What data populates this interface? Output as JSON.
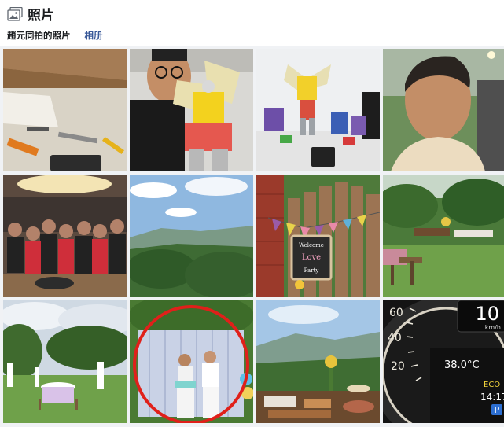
{
  "header": {
    "title": "照片",
    "icon": "photos-icon"
  },
  "tabs": [
    {
      "label": "趙元同拍的照片",
      "active": true
    },
    {
      "label": "相册",
      "active": false
    }
  ],
  "colors": {
    "link": "#385898",
    "annotation_circle": "#e0201a"
  },
  "grid_photos": [
    {
      "name": "photo-workbench-tools"
    },
    {
      "name": "photo-selfie-with-robot-toy"
    },
    {
      "name": "photo-robot-toys-on-table"
    },
    {
      "name": "photo-man-portrait-outdoor"
    },
    {
      "name": "photo-group-dinner"
    },
    {
      "name": "photo-mountain-view"
    },
    {
      "name": "photo-welcome-sign-fence"
    },
    {
      "name": "photo-garden-party-tables"
    },
    {
      "name": "photo-outdoor-wedding"
    },
    {
      "name": "photo-couple-backdrop-circled"
    },
    {
      "name": "photo-mountain-food-table"
    },
    {
      "name": "photo-car-dashboard"
    }
  ],
  "dashboard": {
    "speed": "10",
    "speed_unit": "km/h",
    "temperature": "38.0°C",
    "mode": "ECO",
    "time": "14:17",
    "gear": "P",
    "scale": [
      "60",
      "40",
      "20"
    ]
  },
  "sign_text": [
    "Welcome",
    "Love",
    "Party"
  ]
}
